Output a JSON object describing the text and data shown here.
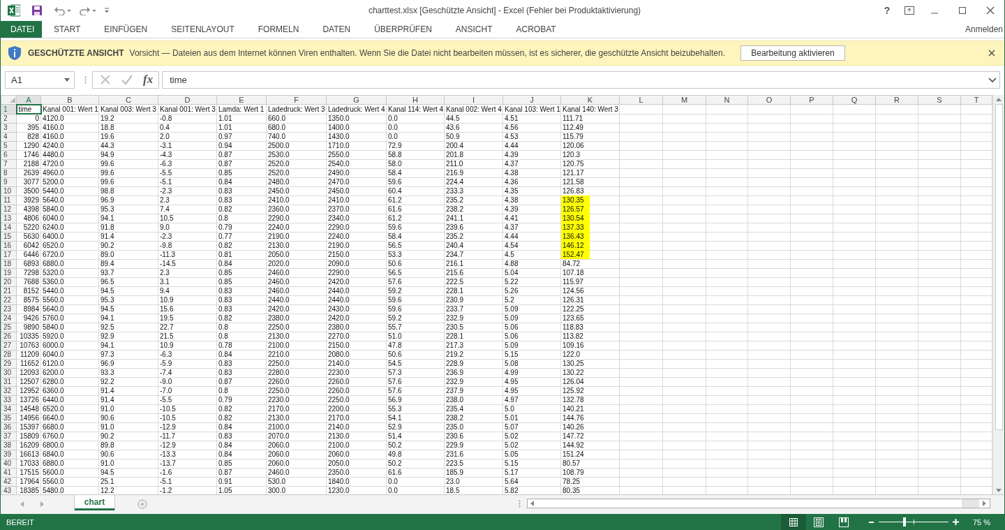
{
  "window": {
    "title": "charttest.xlsx  [Geschützte Ansicht] - Excel (Fehler bei Produktaktivierung)",
    "help": "?"
  },
  "ribbon": {
    "tabs": [
      {
        "label": "DATEI",
        "kind": "file"
      },
      {
        "label": "START",
        "kind": "tab"
      },
      {
        "label": "EINFÜGEN",
        "kind": "tab"
      },
      {
        "label": "SEITENLAYOUT",
        "kind": "tab"
      },
      {
        "label": "FORMELN",
        "kind": "tab"
      },
      {
        "label": "DATEN",
        "kind": "tab"
      },
      {
        "label": "ÜBERPRÜFEN",
        "kind": "tab"
      },
      {
        "label": "ANSICHT",
        "kind": "tab"
      },
      {
        "label": "ACROBAT",
        "kind": "tab"
      }
    ],
    "account": "Anmelden"
  },
  "protected_view": {
    "title": "GESCHÜTZTE ANSICHT",
    "message": "Vorsicht — Dateien aus dem Internet können Viren enthalten. Wenn Sie die Datei nicht bearbeiten müssen, ist es sicherer, die geschützte Ansicht beizubehalten.",
    "button": "Bearbeitung aktivieren"
  },
  "formula_bar": {
    "name_box": "A1",
    "function_label": "fx",
    "value": "time"
  },
  "grid": {
    "columns": [
      {
        "label": "A",
        "selected": true
      },
      {
        "label": "B",
        "selected": false
      },
      {
        "label": "C",
        "selected": false
      },
      {
        "label": "D",
        "selected": false
      },
      {
        "label": "E",
        "selected": false
      },
      {
        "label": "F",
        "selected": false
      },
      {
        "label": "G",
        "selected": false
      },
      {
        "label": "H",
        "selected": false
      },
      {
        "label": "I",
        "selected": false
      },
      {
        "label": "J",
        "selected": false
      },
      {
        "label": "K",
        "selected": false
      },
      {
        "label": "L",
        "selected": false
      },
      {
        "label": "M",
        "selected": false
      },
      {
        "label": "N",
        "selected": false
      },
      {
        "label": "O",
        "selected": false
      },
      {
        "label": "P",
        "selected": false
      },
      {
        "label": "Q",
        "selected": false
      },
      {
        "label": "R",
        "selected": false
      },
      {
        "label": "S",
        "selected": false
      },
      {
        "label": "T",
        "selected": false
      }
    ],
    "rows": [
      {
        "number": "1",
        "selected": true,
        "highlighted": false,
        "cells": [
          "time",
          "Kanal 001: Wert 1",
          "Kanal 003: Wert 3",
          "Kanal 001: Wert 3",
          "Lamda: Wert 1",
          "Ladedruck: Wert 3",
          "Ladedruck: Wert 4",
          "Kanal 114: Wert 4",
          "Kanal 002: Wert 4",
          "Kanal 103: Wert 1",
          "Kanal 140: Wert 3"
        ]
      },
      {
        "number": "2",
        "selected": false,
        "highlighted": false,
        "cells": [
          "0",
          "4120.0",
          "19.2",
          "-0.8",
          "1.01",
          "660.0",
          "1350.0",
          "0.0",
          "44.5",
          "4.51",
          "111.71"
        ]
      },
      {
        "number": "3",
        "selected": false,
        "highlighted": false,
        "cells": [
          "395",
          "4160.0",
          "18.8",
          "0.4",
          "1.01",
          "680.0",
          "1400.0",
          "0.0",
          "43.6",
          "4.56",
          "112.49"
        ]
      },
      {
        "number": "4",
        "selected": false,
        "highlighted": false,
        "cells": [
          "828",
          "4160.0",
          "19.6",
          "2.0",
          "0.97",
          "740.0",
          "1430.0",
          "0.0",
          "50.9",
          "4.53",
          "115.79"
        ]
      },
      {
        "number": "5",
        "selected": false,
        "highlighted": false,
        "cells": [
          "1290",
          "4240.0",
          "44.3",
          "-3.1",
          "0.94",
          "2500.0",
          "1710.0",
          "72.9",
          "200.4",
          "4.44",
          "120.06"
        ]
      },
      {
        "number": "6",
        "selected": false,
        "highlighted": false,
        "cells": [
          "1746",
          "4480.0",
          "94.9",
          "-4.3",
          "0.87",
          "2530.0",
          "2550.0",
          "58.8",
          "201.8",
          "4.39",
          "120.3"
        ]
      },
      {
        "number": "7",
        "selected": false,
        "highlighted": false,
        "cells": [
          "2188",
          "4720.0",
          "99.6",
          "-6.3",
          "0.87",
          "2520.0",
          "2540.0",
          "58.0",
          "211.0",
          "4.37",
          "120.75"
        ]
      },
      {
        "number": "8",
        "selected": false,
        "highlighted": false,
        "cells": [
          "2639",
          "4960.0",
          "99.6",
          "-5.5",
          "0.85",
          "2520.0",
          "2490.0",
          "58.4",
          "216.9",
          "4.38",
          "121.17"
        ]
      },
      {
        "number": "9",
        "selected": false,
        "highlighted": false,
        "cells": [
          "3077",
          "5200.0",
          "99.6",
          "-5.1",
          "0.84",
          "2480.0",
          "2470.0",
          "59.6",
          "224.4",
          "4.36",
          "121.58"
        ]
      },
      {
        "number": "10",
        "selected": false,
        "highlighted": false,
        "cells": [
          "3500",
          "5440.0",
          "98.8",
          "-2.3",
          "0.83",
          "2450.0",
          "2450.0",
          "60.4",
          "233.3",
          "4.35",
          "126.83"
        ]
      },
      {
        "number": "11",
        "selected": false,
        "highlighted": true,
        "cells": [
          "3929",
          "5640.0",
          "96.9",
          "2.3",
          "0.83",
          "2410.0",
          "2410.0",
          "61.2",
          "235.2",
          "4.38",
          "130.35"
        ]
      },
      {
        "number": "12",
        "selected": false,
        "highlighted": true,
        "cells": [
          "4398",
          "5840.0",
          "95.3",
          "7.4",
          "0.82",
          "2360.0",
          "2370.0",
          "61.6",
          "238.2",
          "4.39",
          "126.57"
        ]
      },
      {
        "number": "13",
        "selected": false,
        "highlighted": true,
        "cells": [
          "4806",
          "6040.0",
          "94.1",
          "10.5",
          "0.8",
          "2290.0",
          "2340.0",
          "61.2",
          "241.1",
          "4.41",
          "130.54"
        ]
      },
      {
        "number": "14",
        "selected": false,
        "highlighted": true,
        "cells": [
          "5220",
          "6240.0",
          "91.8",
          "9.0",
          "0.79",
          "2240.0",
          "2290.0",
          "59.6",
          "239.6",
          "4.37",
          "137.33"
        ]
      },
      {
        "number": "15",
        "selected": false,
        "highlighted": true,
        "cells": [
          "5630",
          "6400.0",
          "91.4",
          "-2.3",
          "0.77",
          "2190.0",
          "2240.0",
          "58.4",
          "235.2",
          "4.44",
          "136.43"
        ]
      },
      {
        "number": "16",
        "selected": false,
        "highlighted": true,
        "cells": [
          "6042",
          "6520.0",
          "90.2",
          "-9.8",
          "0.82",
          "2130.0",
          "2190.0",
          "56.5",
          "240.4",
          "4.54",
          "146.12"
        ]
      },
      {
        "number": "17",
        "selected": false,
        "highlighted": true,
        "cells": [
          "6446",
          "6720.0",
          "89.0",
          "-11.3",
          "0.81",
          "2050.0",
          "2150.0",
          "53.3",
          "234.7",
          "4.5",
          "152.47"
        ]
      },
      {
        "number": "18",
        "selected": false,
        "highlighted": false,
        "cells": [
          "6893",
          "6880.0",
          "89.4",
          "-14.5",
          "0.84",
          "2020.0",
          "2090.0",
          "50.6",
          "216.1",
          "4.88",
          "84.72"
        ]
      },
      {
        "number": "19",
        "selected": false,
        "highlighted": false,
        "cells": [
          "7298",
          "5320.0",
          "93.7",
          "2.3",
          "0.85",
          "2460.0",
          "2290.0",
          "56.5",
          "215.6",
          "5.04",
          "107.18"
        ]
      },
      {
        "number": "20",
        "selected": false,
        "highlighted": false,
        "cells": [
          "7688",
          "5360.0",
          "96.5",
          "3.1",
          "0.85",
          "2460.0",
          "2420.0",
          "57.6",
          "222.5",
          "5.22",
          "115.97"
        ]
      },
      {
        "number": "21",
        "selected": false,
        "highlighted": false,
        "cells": [
          "8152",
          "5440.0",
          "94.5",
          "9.4",
          "0.83",
          "2460.0",
          "2440.0",
          "59.2",
          "228.1",
          "5.26",
          "124.56"
        ]
      },
      {
        "number": "22",
        "selected": false,
        "highlighted": false,
        "cells": [
          "8575",
          "5560.0",
          "95.3",
          "10.9",
          "0.83",
          "2440.0",
          "2440.0",
          "59.6",
          "230.9",
          "5.2",
          "126.31"
        ]
      },
      {
        "number": "23",
        "selected": false,
        "highlighted": false,
        "cells": [
          "8984",
          "5640.0",
          "94.5",
          "15.6",
          "0.83",
          "2420.0",
          "2430.0",
          "59.6",
          "233.7",
          "5.09",
          "122.25"
        ]
      },
      {
        "number": "24",
        "selected": false,
        "highlighted": false,
        "cells": [
          "9426",
          "5760.0",
          "94.1",
          "19.5",
          "0.82",
          "2380.0",
          "2420.0",
          "59.2",
          "232.9",
          "5.09",
          "123.65"
        ]
      },
      {
        "number": "25",
        "selected": false,
        "highlighted": false,
        "cells": [
          "9890",
          "5840.0",
          "92.5",
          "22.7",
          "0.8",
          "2250.0",
          "2380.0",
          "55.7",
          "230.5",
          "5.06",
          "118.83"
        ]
      },
      {
        "number": "26",
        "selected": false,
        "highlighted": false,
        "cells": [
          "10335",
          "5920.0",
          "92.9",
          "21.5",
          "0.8",
          "2130.0",
          "2270.0",
          "51.0",
          "228.1",
          "5.06",
          "113.82"
        ]
      },
      {
        "number": "27",
        "selected": false,
        "highlighted": false,
        "cells": [
          "10763",
          "6000.0",
          "94.1",
          "10.9",
          "0.78",
          "2100.0",
          "2150.0",
          "47.8",
          "217.3",
          "5.09",
          "109.16"
        ]
      },
      {
        "number": "28",
        "selected": false,
        "highlighted": false,
        "cells": [
          "11209",
          "6040.0",
          "97.3",
          "-6.3",
          "0.84",
          "2210.0",
          "2080.0",
          "50.6",
          "219.2",
          "5.15",
          "122.0"
        ]
      },
      {
        "number": "29",
        "selected": false,
        "highlighted": false,
        "cells": [
          "11652",
          "6120.0",
          "96.9",
          "-5.9",
          "0.83",
          "2250.0",
          "2140.0",
          "54.5",
          "228.9",
          "5.08",
          "130.25"
        ]
      },
      {
        "number": "30",
        "selected": false,
        "highlighted": false,
        "cells": [
          "12093",
          "6200.0",
          "93.3",
          "-7.4",
          "0.83",
          "2280.0",
          "2230.0",
          "57.3",
          "236.9",
          "4.99",
          "130.22"
        ]
      },
      {
        "number": "31",
        "selected": false,
        "highlighted": false,
        "cells": [
          "12507",
          "6280.0",
          "92.2",
          "-9.0",
          "0.87",
          "2260.0",
          "2260.0",
          "57.6",
          "232.9",
          "4.95",
          "126.04"
        ]
      },
      {
        "number": "32",
        "selected": false,
        "highlighted": false,
        "cells": [
          "12952",
          "6360.0",
          "91.4",
          "-7.0",
          "0.8",
          "2250.0",
          "2260.0",
          "57.6",
          "237.9",
          "4.95",
          "125.92"
        ]
      },
      {
        "number": "33",
        "selected": false,
        "highlighted": false,
        "cells": [
          "13726",
          "6440.0",
          "91.4",
          "-5.5",
          "0.79",
          "2230.0",
          "2250.0",
          "56.9",
          "238.0",
          "4.97",
          "132.78"
        ]
      },
      {
        "number": "34",
        "selected": false,
        "highlighted": false,
        "cells": [
          "14548",
          "6520.0",
          "91.0",
          "-10.5",
          "0.82",
          "2170.0",
          "2200.0",
          "55.3",
          "235.4",
          "5.0",
          "140.21"
        ]
      },
      {
        "number": "35",
        "selected": false,
        "highlighted": false,
        "cells": [
          "14956",
          "6640.0",
          "90.6",
          "-10.5",
          "0.82",
          "2130.0",
          "2170.0",
          "54.1",
          "238.2",
          "5.01",
          "144.76"
        ]
      },
      {
        "number": "36",
        "selected": false,
        "highlighted": false,
        "cells": [
          "15397",
          "6680.0",
          "91.0",
          "-12.9",
          "0.84",
          "2100.0",
          "2140.0",
          "52.9",
          "235.0",
          "5.07",
          "140.26"
        ]
      },
      {
        "number": "37",
        "selected": false,
        "highlighted": false,
        "cells": [
          "15809",
          "6760.0",
          "90.2",
          "-11.7",
          "0.83",
          "2070.0",
          "2130.0",
          "51.4",
          "230.6",
          "5.02",
          "147.72"
        ]
      },
      {
        "number": "38",
        "selected": false,
        "highlighted": false,
        "cells": [
          "16209",
          "6800.0",
          "89.8",
          "-12.9",
          "0.84",
          "2060.0",
          "2100.0",
          "50.2",
          "229.9",
          "5.02",
          "144.92"
        ]
      },
      {
        "number": "39",
        "selected": false,
        "highlighted": false,
        "cells": [
          "16613",
          "6840.0",
          "90.6",
          "-13.3",
          "0.84",
          "2060.0",
          "2060.0",
          "49.8",
          "231.6",
          "5.05",
          "151.24"
        ]
      },
      {
        "number": "40",
        "selected": false,
        "highlighted": false,
        "cells": [
          "17033",
          "6880.0",
          "91.0",
          "-13.7",
          "0.85",
          "2060.0",
          "2050.0",
          "50.2",
          "223.5",
          "5.15",
          "80.57"
        ]
      },
      {
        "number": "41",
        "selected": false,
        "highlighted": false,
        "cells": [
          "17515",
          "5600.0",
          "94.5",
          "-1.6",
          "0.87",
          "2460.0",
          "2350.0",
          "61.6",
          "185.9",
          "5.17",
          "108.79"
        ]
      },
      {
        "number": "42",
        "selected": false,
        "highlighted": false,
        "cells": [
          "17964",
          "5560.0",
          "25.1",
          "-5.1",
          "0.91",
          "530.0",
          "1840.0",
          "0.0",
          "23.0",
          "5.64",
          "78.25"
        ]
      },
      {
        "number": "43",
        "selected": false,
        "highlighted": false,
        "cells": [
          "18385",
          "5480.0",
          "12.2",
          "-1.2",
          "1.05",
          "300.0",
          "1230.0",
          "0.0",
          "18.5",
          "5.82",
          "80.35"
        ]
      }
    ]
  },
  "sheet_tabs": [
    {
      "label": "chart",
      "selected": true
    }
  ],
  "status_bar": {
    "status": "BEREIT",
    "views": [
      {
        "kind": "normal",
        "selected": true
      },
      {
        "kind": "page_layout",
        "selected": false
      },
      {
        "kind": "page_break",
        "selected": false
      }
    ],
    "zoom": {
      "level": 0.37,
      "reading": "75 %"
    }
  }
}
